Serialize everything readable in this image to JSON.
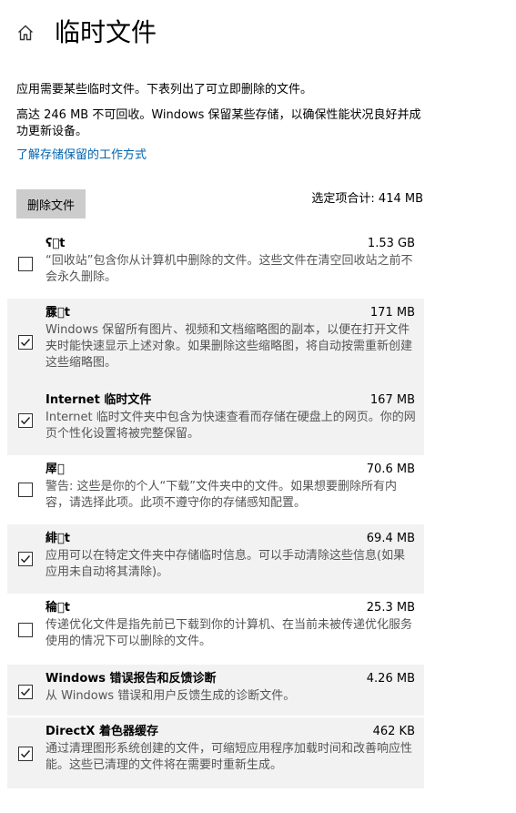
{
  "page": {
    "title": "临时文件",
    "description1": "应用需要某些临时文件。下表列出了可立即删除的文件。",
    "description2": "高达 246 MB 不可回收。Windows 保留某些存储，以确保性能状况良好并成功更新设备。",
    "learn_link": "了解存储保留的工作方式",
    "delete_button": "删除文件",
    "selected_total": "选定项合计: 414 MB"
  },
  "icons": {
    "home": "home-icon",
    "check": "checkmark-icon"
  },
  "colors": {
    "link": "#0063b1",
    "button_bg": "#cccccc",
    "checked_row_bg": "#f2f2f2"
  },
  "items": [
    {
      "title": "ʕ\u0000t",
      "size": "1.53 GB",
      "checked": false,
      "description": "“回收站”包含你从计算机中删除的文件。这些文件在清空回收站之前不会永久删除。"
    },
    {
      "title": "霡\u0000t",
      "size": "171 MB",
      "checked": true,
      "description": "Windows 保留所有图片、视频和文档缩略图的副本，以便在打开文件夹时能快速显示上述对象。如果删除这些缩略图，将自动按需重新创建这些缩略图。"
    },
    {
      "title": "Internet 临时文件",
      "size": "167 MB",
      "checked": true,
      "description": "Internet 临时文件夹中包含为快速查看而存储在硬盘上的网页。你的网页个性化设置将被完整保留。"
    },
    {
      "title": "屖\u0000",
      "size": "70.6 MB",
      "checked": false,
      "description": "警告: 这些是你的个人“下载”文件夹中的文件。如果想要删除所有内容，请选择此项。此项不遵守你的存储感知配置。"
    },
    {
      "title": "緋\u0000t",
      "size": "69.4 MB",
      "checked": true,
      "description": "应用可以在特定文件夹中存储临时信息。可以手动清除这些信息(如果应用未自动将其清除)。"
    },
    {
      "title": "稐\u0000t",
      "size": "25.3 MB",
      "checked": false,
      "description": "传递优化文件是指先前已下载到你的计算机、在当前未被传递优化服务使用的情况下可以删除的文件。"
    },
    {
      "title": "Windows 错误报告和反馈诊断",
      "size": "4.26 MB",
      "checked": true,
      "description": "从 Windows 错误和用户反馈生成的诊断文件。"
    },
    {
      "title": "DirectX 着色器缓存",
      "size": "462 KB",
      "checked": true,
      "description": "通过清理图形系统创建的文件，可缩短应用程序加载时间和改善响应性能。这些已清理的文件将在需要时重新生成。"
    }
  ]
}
